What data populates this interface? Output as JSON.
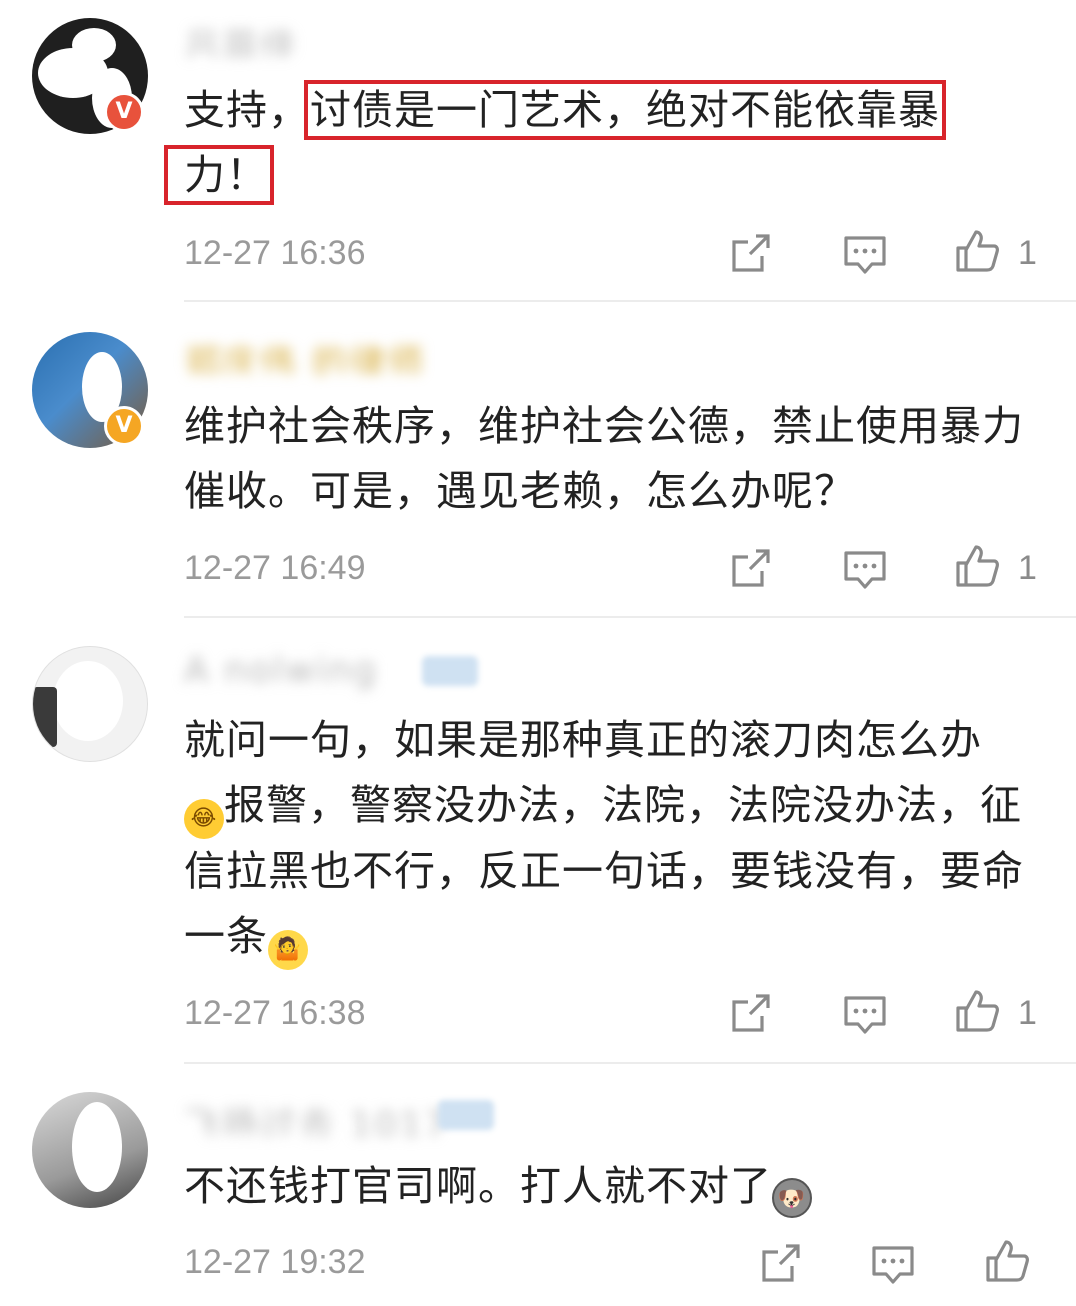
{
  "comments": [
    {
      "username": "吕菲佳",
      "text_prefix": "支持，",
      "text_highlight_1": "讨债是一门艺术，绝对不能依靠暴",
      "text_highlight_2": "力！",
      "time": "12-27 16:36",
      "likes": "1",
      "badge": "V",
      "actions": [
        "share-icon",
        "comment-icon",
        "thumbs-up-icon"
      ]
    },
    {
      "username": "郑庆伟 的律师",
      "text": "维护社会秩序，维护社会公德，禁止使用暴力催收。可是，遇见老赖，怎么办呢？",
      "time": "12-27 16:49",
      "likes": "1",
      "badge": "V",
      "actions": [
        "share-icon",
        "comment-icon",
        "thumbs-up-icon"
      ]
    },
    {
      "username": "A nolwing",
      "text_1": "就问一句，如果是那种真正的滚刀肉怎么办",
      "text_2": "报警，警察没办法，法院，法院没办法，征信拉黑也不行，反正一句话，要钱没有，要命一条",
      "emoji_1": "laughing-tears-emoji",
      "emoji_2": "shrug-emoji",
      "time": "12-27 16:38",
      "likes": "1",
      "actions": [
        "share-icon",
        "comment-icon",
        "thumbs-up-icon"
      ]
    },
    {
      "username": "飞扬过去 1017",
      "text": "不还钱打官司啊。打人就不对了",
      "emoji": "husky-emoji",
      "time": "12-27 19:32",
      "actions": [
        "share-icon",
        "comment-icon",
        "thumbs-up-icon"
      ]
    }
  ],
  "colors": {
    "highlight_border": "#d8242b",
    "timestamp": "#9a9a9a",
    "text": "#222222",
    "icon": "#8a8a8a",
    "verified_badge": "#f5a623"
  }
}
